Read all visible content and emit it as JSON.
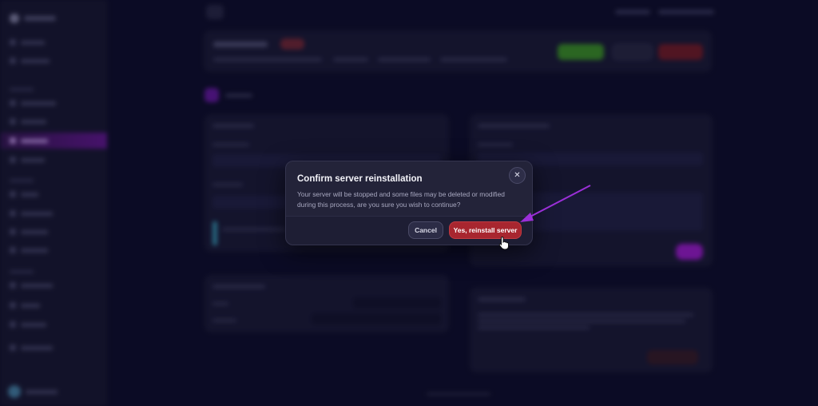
{
  "modal": {
    "title": "Confirm server reinstallation",
    "message": "Your server will be stopped and some files may be deleted or modified during this process, are you sure you wish to continue?",
    "close_icon": "close-icon",
    "cancel_label": "Cancel",
    "confirm_label": "Yes, reinstall server"
  },
  "colors": {
    "background": "#0f0f2e",
    "modal": "#232339",
    "confirm_button": "#a8262f",
    "sidebar_active": "#6a1a9a",
    "annotation_arrow": "#9b2fd8"
  }
}
